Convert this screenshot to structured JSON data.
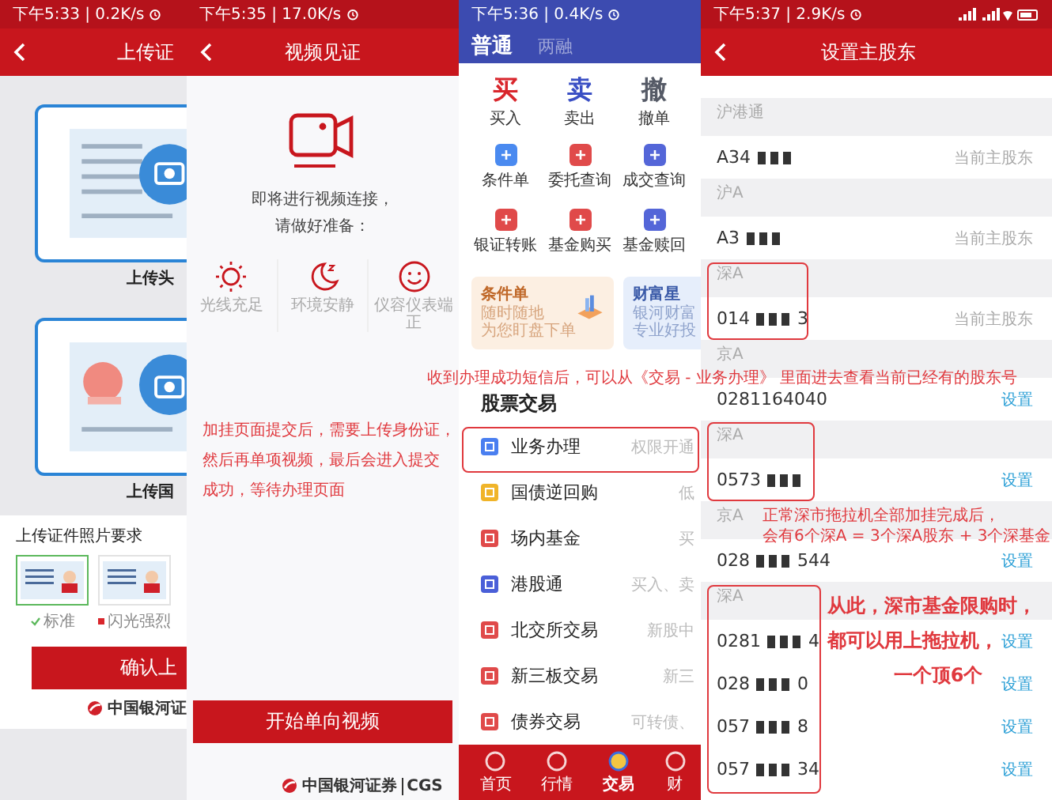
{
  "upload_screen": {
    "status_time": "下午5:33 | 0.2K/s",
    "title": "上传证",
    "cards": [
      {
        "caption": "上传头",
        "kind": "portrait"
      },
      {
        "caption": "上传国",
        "kind": "emblem"
      }
    ],
    "requirements_label": "上传证件照片要求",
    "samples": [
      {
        "label": "标准",
        "selected": true
      },
      {
        "label": "闪光强烈",
        "selected": false
      }
    ],
    "confirm_button": "确认上",
    "brand": "中国银河证"
  },
  "video_screen": {
    "status_time": "下午5:35 | 17.0K/s",
    "title": "视频见证",
    "prompt": [
      "即将进行视频连接，",
      "请做好准备："
    ],
    "tips": [
      {
        "kind": "sun",
        "label": "光线充足"
      },
      {
        "kind": "moon",
        "label": "环境安静"
      },
      {
        "kind": "smile",
        "label": "仪容仪表端正"
      }
    ],
    "start_button": "开始单向视频",
    "brand": "中国银河证券",
    "brand_latin": "CGS"
  },
  "trade_screen": {
    "status_time": "下午5:36 | 0.4K/s",
    "tabs": [
      {
        "label": "普通",
        "selected": true
      },
      {
        "label": "两融",
        "selected": false
      }
    ],
    "primary_actions": [
      {
        "glyph": "买",
        "label": "买入",
        "color": "#d9262c"
      },
      {
        "glyph": "卖",
        "label": "卖出",
        "color": "#3a4fc4"
      },
      {
        "glyph": "撤",
        "label": "撤单",
        "color": "#555a66"
      }
    ],
    "tools": [
      {
        "label": "条件单",
        "color": "#4a8af0"
      },
      {
        "label": "委托查询",
        "color": "#e04a4a"
      },
      {
        "label": "成交查询",
        "color": "#5466d8"
      },
      {
        "label": "银证转账",
        "color": "#e04a4a"
      },
      {
        "label": "基金购买",
        "color": "#e04a4a"
      },
      {
        "label": "基金赎回",
        "color": "#5466d8"
      }
    ],
    "banners": [
      {
        "kind": "condition",
        "title": "条件单",
        "lines": [
          "随时随地",
          "为您盯盘下单"
        ]
      },
      {
        "kind": "wealth",
        "title": "财富星",
        "lines": [
          "银河财富",
          "专业好投"
        ]
      }
    ],
    "section_title": "股票交易",
    "menu": [
      {
        "label": "业务办理",
        "hint": "权限开通",
        "color": "#4a7ff0"
      },
      {
        "label": "国债逆回购",
        "hint": "低",
        "color": "#f0b429"
      },
      {
        "label": "场内基金",
        "hint": "买",
        "color": "#e04a4a"
      },
      {
        "label": "港股通",
        "hint": "买入、卖",
        "color": "#4a5fd8"
      },
      {
        "label": "北交所交易",
        "hint": "新股中",
        "color": "#e04a4a"
      },
      {
        "label": "新三板交易",
        "hint": "新三",
        "color": "#e04a4a"
      },
      {
        "label": "债券交易",
        "hint": "可转债、",
        "color": "#e04a4a"
      }
    ],
    "bottom_nav": [
      {
        "label": "首页",
        "selected": false
      },
      {
        "label": "行情",
        "selected": false
      },
      {
        "label": "交易",
        "selected": true
      },
      {
        "label": "财",
        "selected": false
      }
    ]
  },
  "shareholder_screen": {
    "status_time": "下午5:37 | 2.9K/s",
    "title": "设置主股东",
    "groups": [
      {
        "market": "沪港通",
        "accounts": [
          {
            "number_start": "A34",
            "masked": true,
            "kind": "current",
            "action": "当前主股东"
          }
        ]
      },
      {
        "market": "沪A",
        "accounts": [
          {
            "number_start": "A3",
            "masked": true,
            "kind": "current",
            "action": "当前主股东"
          }
        ]
      },
      {
        "market": "深A",
        "accounts": [
          {
            "number_start": "014",
            "masked": true,
            "number_end": "3",
            "kind": "current",
            "action": "当前主股东"
          }
        ]
      },
      {
        "market": "京A",
        "accounts": [
          {
            "number_start": "0281164040",
            "masked": false,
            "kind": "set",
            "action": "设置"
          }
        ]
      },
      {
        "market": "深A",
        "accounts": [
          {
            "number_start": "0573",
            "masked": true,
            "kind": "set",
            "action": "设置"
          }
        ]
      },
      {
        "market": "京A",
        "accounts": [
          {
            "number_start": "028",
            "masked": true,
            "number_end": "544",
            "kind": "set",
            "action": "设置"
          }
        ]
      },
      {
        "market": "深A",
        "accounts": [
          {
            "number_start": "0281",
            "masked": true,
            "number_end": "4",
            "kind": "set",
            "action": "设置"
          },
          {
            "number_start": "028",
            "masked": true,
            "number_end": "0",
            "kind": "set",
            "action": "设置"
          },
          {
            "number_start": "057",
            "masked": true,
            "number_end": "8",
            "kind": "set",
            "action": "设置"
          },
          {
            "number_start": "057",
            "masked": true,
            "number_end": "34",
            "kind": "set",
            "action": "设置"
          }
        ]
      }
    ]
  },
  "annotations": [
    {
      "kind": "note",
      "lines": [
        "加挂页面提交后，需要上传身份证，",
        "然后再单项视频，最后会进入提交",
        "成功，等待办理页面"
      ]
    },
    {
      "kind": "note",
      "lines": [
        "收到办理成功短信后，可以从《交易 - 业务办理》 里面进去查看当前已经有的股东号"
      ]
    },
    {
      "kind": "note",
      "lines": [
        "正常深市拖拉机全部加挂完成后，",
        "会有6个深A = 3个深A股东 + 3个深基金"
      ]
    },
    {
      "kind": "emphasis",
      "lines": [
        "从此，深市基金限购时，",
        "都可以用上拖拉机，",
        "一个顶6个"
      ]
    }
  ]
}
